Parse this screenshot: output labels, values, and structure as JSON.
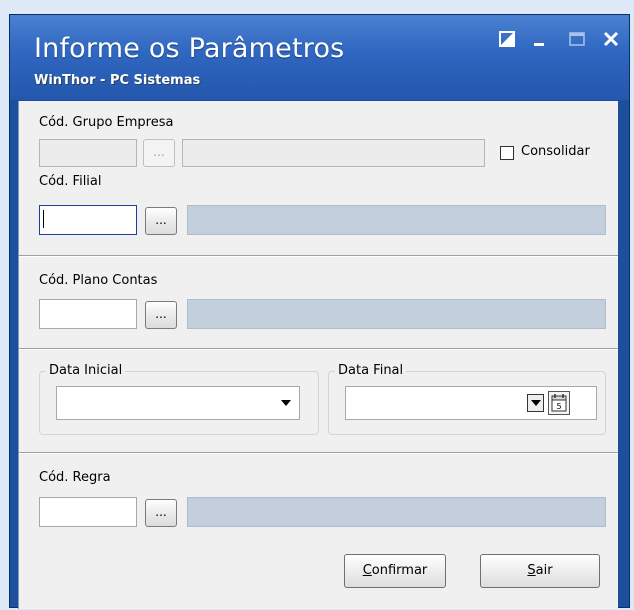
{
  "window": {
    "title": "Informe os Parâmetros",
    "subtitle": "WinThor - PC Sistemas",
    "buttons": [
      "restore-icon",
      "minimize-icon",
      "maximize-icon",
      "close-icon"
    ]
  },
  "grupo_empresa": {
    "label": "Cód. Grupo Empresa",
    "code": "",
    "desc": "",
    "lookup": "..."
  },
  "consolidar": {
    "label": "Consolidar",
    "checked": false
  },
  "filial": {
    "label": "Cód. Filial",
    "code": "",
    "desc": "",
    "lookup": "..."
  },
  "plano_contas": {
    "label": "Cód. Plano Contas",
    "code": "",
    "desc": "",
    "lookup": "..."
  },
  "data_inicial": {
    "label": "Data Inicial",
    "value": ""
  },
  "data_final": {
    "label": "Data Final",
    "value": ""
  },
  "regra": {
    "label": "Cód. Regra",
    "code": "",
    "desc": "",
    "lookup": "..."
  },
  "actions": {
    "confirmar": {
      "underline": "C",
      "rest": "onfirmar"
    },
    "sair": {
      "underline": "S",
      "rest": "air"
    }
  }
}
